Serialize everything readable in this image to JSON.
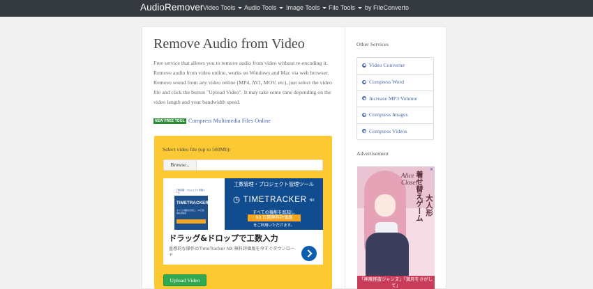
{
  "navbar": {
    "brand": "AudioRemover",
    "items": [
      {
        "label": "Video Tools",
        "dropdown": true
      },
      {
        "label": "Audio Tools",
        "dropdown": true
      },
      {
        "label": "Image Tools",
        "dropdown": true
      },
      {
        "label": "File Tools",
        "dropdown": true
      },
      {
        "label": "by FileConverto",
        "dropdown": false
      }
    ]
  },
  "main": {
    "title": "Remove Audio from Video",
    "intro": "Free service that allows you to remove audio from video without re-encoding it. Remove audio from video online, works on Windows and Mac via web browser. Remove sound from any video online (MP4, AVI, MOV, etc), just select the video file and click the button \"Upload Video\". It may take some time depending on the video length and your bandwidth speed.",
    "new_tool_badge": "NEW FREE TOOL",
    "new_tool_link": "Compress Multimedia Files Online"
  },
  "upload": {
    "label": "Select video file (up to 500Mb):",
    "browse_label": "Browse...",
    "file_value": "",
    "button_label": "Upload Video"
  },
  "ad_banner": {
    "thumb_top": "工数管理・プロジェクト管理ツール",
    "thumb_logo": "TIMETRACKER",
    "thumb_sub": "すべての機能を既知し、90日間無料評価版",
    "hero_top": "工数管理・プロジェクト管理ツール",
    "hero_logo": "TIMETRACKER",
    "hero_logo_suffix": "NX",
    "hero_line1": "すべての機能を既知し",
    "hero_highlight": "90 日間無料評価版",
    "hero_line2": "をご利用いただけます。",
    "headline": "ドラッグ&ドロップで工数入力",
    "description": "直感的な操作のTimeTracker NX 無料評価版を今すぐダウンロード"
  },
  "sidebar": {
    "title": "Other Services",
    "services": [
      {
        "label": "Video Converter",
        "icon": "circle-arrow-icon"
      },
      {
        "label": "Compress Word",
        "icon": "circle-arrow-icon"
      },
      {
        "label": "Increase MP3 Volume",
        "icon": "circle-arrow-icon"
      },
      {
        "label": "Compress Images",
        "icon": "circle-arrow-icon"
      },
      {
        "label": "Compress Videos",
        "icon": "circle-arrow-icon"
      }
    ],
    "ad_title": "Advertisement",
    "side_ad": {
      "close": "✕",
      "eng_title": "Alice Closet",
      "vertical_text_1": "着せ替えゲーム",
      "vertical_text_2": "大人形",
      "bottom_text": "「神風怪盗ジャンヌ」「満月をさがして」"
    }
  },
  "colors": {
    "navbar_bg": "#34393f",
    "page_bg": "#f1f1f1",
    "panel_yellow": "#fcc933",
    "link_blue": "#4a68a8",
    "upload_green": "#2fa84f",
    "badge_green": "#2e8b3a"
  }
}
